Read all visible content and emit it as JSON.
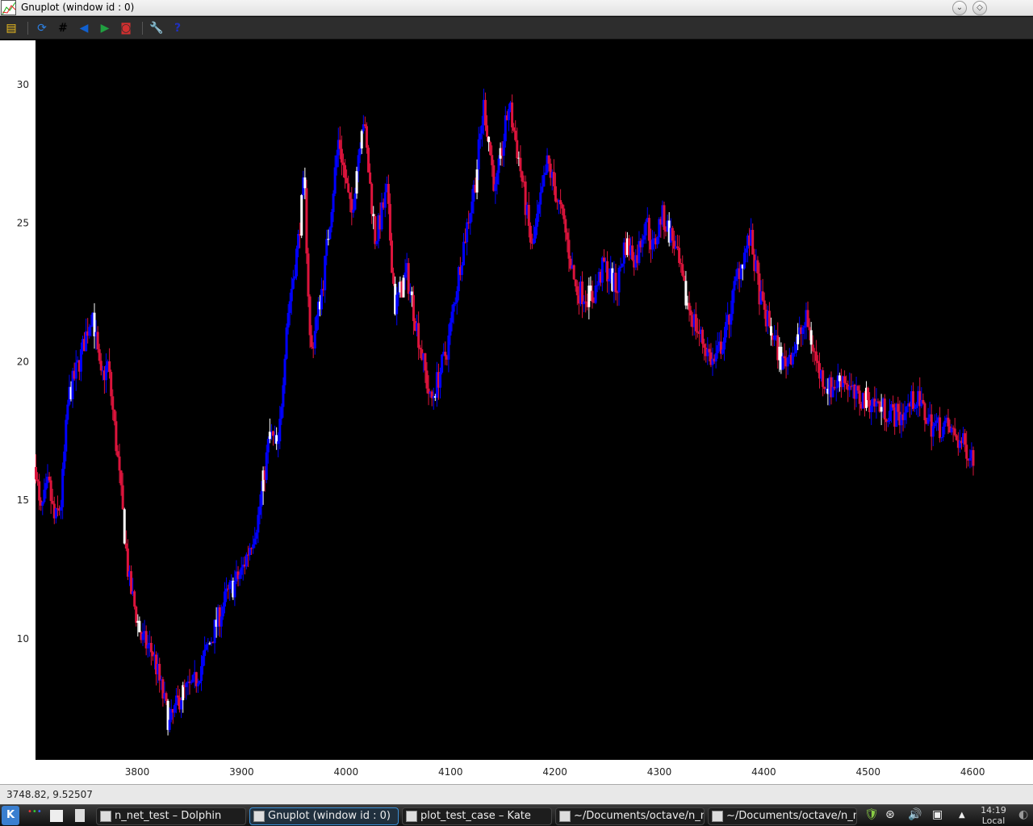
{
  "window": {
    "title": "Gnuplot (window id : 0)"
  },
  "toolbar": {
    "icons": [
      "export-icon",
      "replot-icon",
      "grid-icon",
      "zoom-back-icon",
      "zoom-forward-icon",
      "autoscale-icon",
      "settings-icon",
      "help-icon"
    ]
  },
  "statusbar": {
    "coords": "3748.82,  9.52507"
  },
  "taskbar": {
    "tasks": [
      "n_net_test – Dolphin",
      "Gnuplot (window id : 0)",
      "plot_test_case – Kate",
      "~/Documents/octave/n_n",
      "~/Documents/octave/n_n"
    ],
    "clock_time": "14:19",
    "clock_zone": "Local"
  },
  "colors": {
    "up": "#0000ff",
    "down": "#dc143c",
    "neutral": "#ffffff",
    "plot_bg": "#000000"
  },
  "chart_data": {
    "type": "candlestick",
    "title": "",
    "xlim": [
      3702.6,
      4657.8
    ],
    "ylim": [
      5.63,
      31.6
    ],
    "xticks": [
      3800,
      3900,
      4000,
      4100,
      4200,
      4300,
      4400,
      4500,
      4600
    ],
    "xtick_labels": [
      "3800",
      "3900",
      "4000",
      "4100",
      "4200",
      "4300",
      "4400",
      "4500",
      "4600"
    ],
    "yticks": [
      10,
      15,
      20,
      25,
      30
    ],
    "ytick_labels": [
      "10",
      "15",
      "20",
      "25",
      "30"
    ],
    "grid": false,
    "close_path": [
      [
        3703,
        16.2
      ],
      [
        3707,
        14.4
      ],
      [
        3715,
        15.6
      ],
      [
        3721,
        14.2
      ],
      [
        3727,
        14.9
      ],
      [
        3734,
        18.7
      ],
      [
        3746,
        20.2
      ],
      [
        3757,
        21.9
      ],
      [
        3765,
        19.3
      ],
      [
        3772,
        19.9
      ],
      [
        3781,
        16.6
      ],
      [
        3792,
        12.1
      ],
      [
        3804,
        10.0
      ],
      [
        3815,
        9.5
      ],
      [
        3831,
        6.9
      ],
      [
        3842,
        8.0
      ],
      [
        3854,
        8.3
      ],
      [
        3869,
        9.8
      ],
      [
        3885,
        11.5
      ],
      [
        3900,
        12.4
      ],
      [
        3916,
        14.4
      ],
      [
        3927,
        17.4
      ],
      [
        3935,
        16.8
      ],
      [
        3943,
        21.4
      ],
      [
        3954,
        24.3
      ],
      [
        3960,
        26.6
      ],
      [
        3966,
        20.2
      ],
      [
        3978,
        22.9
      ],
      [
        3993,
        28.1
      ],
      [
        4005,
        25.2
      ],
      [
        4016,
        29.0
      ],
      [
        4028,
        24.4
      ],
      [
        4039,
        26.1
      ],
      [
        4047,
        22.0
      ],
      [
        4058,
        23.2
      ],
      [
        4070,
        20.8
      ],
      [
        4081,
        18.5
      ],
      [
        4097,
        20.5
      ],
      [
        4109,
        23.5
      ],
      [
        4124,
        26.6
      ],
      [
        4132,
        29.3
      ],
      [
        4143,
        26.1
      ],
      [
        4156,
        29.3
      ],
      [
        4166,
        27.2
      ],
      [
        4178,
        24.0
      ],
      [
        4193,
        27.2
      ],
      [
        4209,
        24.9
      ],
      [
        4220,
        22.6
      ],
      [
        4236,
        22.3
      ],
      [
        4247,
        23.5
      ],
      [
        4259,
        22.6
      ],
      [
        4267,
        24.3
      ],
      [
        4278,
        23.7
      ],
      [
        4287,
        25.2
      ],
      [
        4294,
        24.0
      ],
      [
        4302,
        25.3
      ],
      [
        4314,
        24.3
      ],
      [
        4325,
        22.3
      ],
      [
        4337,
        21.1
      ],
      [
        4352,
        19.9
      ],
      [
        4364,
        21.1
      ],
      [
        4375,
        23.2
      ],
      [
        4387,
        24.5
      ],
      [
        4398,
        22.0
      ],
      [
        4410,
        20.8
      ],
      [
        4418,
        19.9
      ],
      [
        4429,
        20.5
      ],
      [
        4441,
        21.5
      ],
      [
        4453,
        19.6
      ],
      [
        4464,
        19.0
      ],
      [
        4476,
        19.5
      ],
      [
        4487,
        18.7
      ],
      [
        4503,
        18.6
      ],
      [
        4514,
        18.3
      ],
      [
        4530,
        18.0
      ],
      [
        4545,
        18.7
      ],
      [
        4561,
        17.7
      ],
      [
        4576,
        17.6
      ],
      [
        4588,
        17.1
      ],
      [
        4602,
        16.6
      ]
    ]
  }
}
